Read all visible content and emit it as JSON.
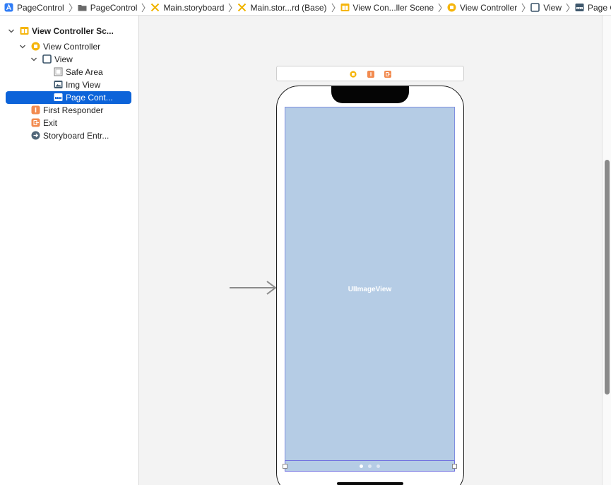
{
  "breadcrumbs": [
    {
      "label": "PageControl",
      "icon": "app-icon"
    },
    {
      "label": "PageControl",
      "icon": "folder-icon"
    },
    {
      "label": "Main.storyboard",
      "icon": "storyboard-icon"
    },
    {
      "label": "Main.stor...rd (Base)",
      "icon": "storyboard-icon"
    },
    {
      "label": "View Con...ller Scene",
      "icon": "scene-icon"
    },
    {
      "label": "View Controller",
      "icon": "view-controller-icon"
    },
    {
      "label": "View",
      "icon": "view-icon"
    },
    {
      "label": "Page Control",
      "icon": "page-control-icon"
    }
  ],
  "outline": {
    "scene": "View Controller Sc...",
    "view_controller": "View Controller",
    "view": "View",
    "safe_area": "Safe Area",
    "img_view": "Img View",
    "page_control": "Page Cont...",
    "first_responder": "First Responder",
    "exit": "Exit",
    "storyboard_entry": "Storyboard Entr..."
  },
  "canvas": {
    "image_view_label": "UIImageView",
    "page_control_dots": 3,
    "selected_dot": 0
  },
  "colors": {
    "selection": "#0c63d9",
    "image_view_fill": "#b5cce5",
    "vc_yellow": "#f5b50c",
    "responder_orange": "#f28b50"
  }
}
